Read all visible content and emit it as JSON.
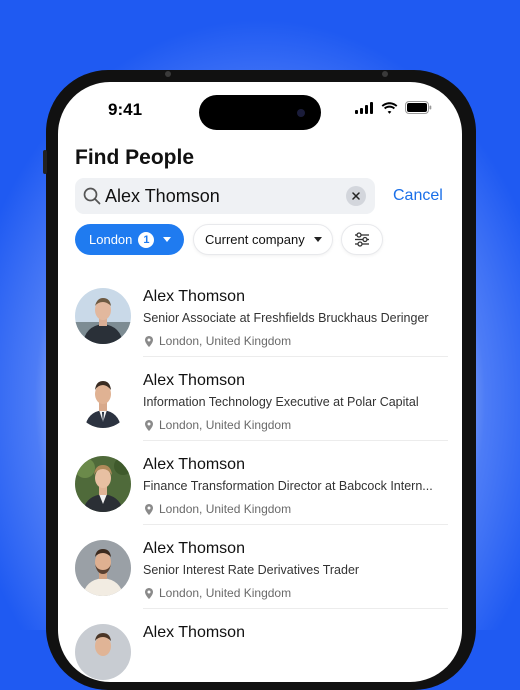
{
  "status_bar": {
    "time": "9:41"
  },
  "page": {
    "title": "Find People"
  },
  "search": {
    "value": "Alex Thomson",
    "cancel_label": "Cancel"
  },
  "filters": {
    "location_label": "London",
    "location_count": "1",
    "company_label": "Current company"
  },
  "results": [
    {
      "name": "Alex Thomson",
      "title": "Senior Associate at Freshfields Bruckhaus Deringer",
      "location": "London, United Kingdom"
    },
    {
      "name": "Alex Thomson",
      "title": "Information Technology Executive at Polar Capital",
      "location": "London, United Kingdom"
    },
    {
      "name": "Alex Thomson",
      "title": "Finance Transformation Director at Babcock Intern...",
      "location": "London, United Kingdom"
    },
    {
      "name": "Alex Thomson",
      "title": "Senior Interest Rate Derivatives Trader",
      "location": "London, United Kingdom"
    },
    {
      "name": "Alex Thomson"
    }
  ],
  "colors": {
    "accent": "#1f7bf0",
    "background": "#1f5af2"
  }
}
